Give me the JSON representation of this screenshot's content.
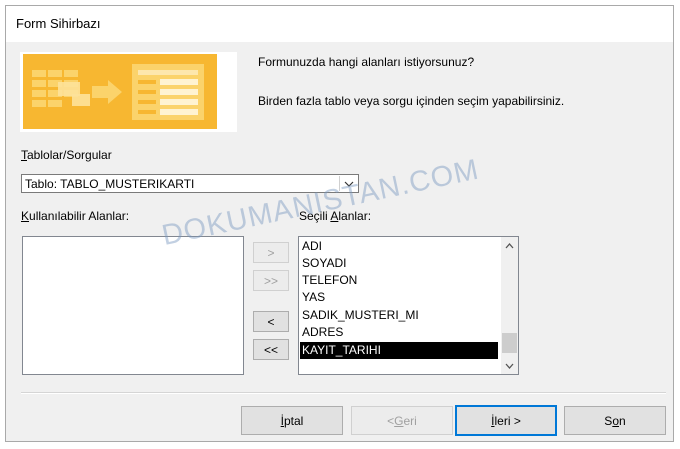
{
  "window": {
    "title": "Form Sihirbazı"
  },
  "prompt": {
    "line1": "Formunuzda hangi alanları istiyorsunuz?",
    "line2": "Birden fazla tablo veya sorgu içinden seçim yapabilirsiniz."
  },
  "tables": {
    "label_accel": "T",
    "label_rest": "ablolar/Sorgular",
    "selected": "Tablo: TABLO_MUSTERIKARTI"
  },
  "available": {
    "label_accel": "K",
    "label_rest": "ullanılabilir Alanlar:",
    "items": []
  },
  "selected_fields": {
    "label_pre": "Seçili ",
    "label_accel": "A",
    "label_rest": "lanlar:",
    "items": [
      "ADI",
      "SOYADI",
      "TELEFON",
      "YAS",
      "SADIK_MUSTERI_MI",
      "ADRES",
      "KAYIT_TARIHI"
    ],
    "highlighted": "KAYIT_TARIHI"
  },
  "move_buttons": {
    "add": ">",
    "add_all": ">>",
    "remove": "<",
    "remove_all": "<<"
  },
  "footer": {
    "cancel_accel": "İ",
    "cancel_rest": "ptal",
    "back_pre": "< ",
    "back_accel": "G",
    "back_rest": "eri",
    "next_accel": "İ",
    "next_rest": "leri >",
    "finish_pre": "S",
    "finish_accel": "o",
    "finish_rest": "n"
  },
  "watermark": "DOKUMANISTAN.COM",
  "colors": {
    "accent": "#0078d7",
    "wizard_art": "#f7b731",
    "selection": "#000000"
  }
}
